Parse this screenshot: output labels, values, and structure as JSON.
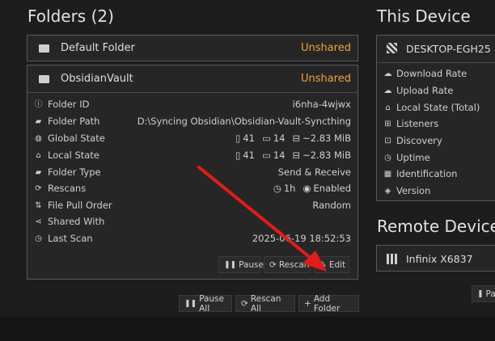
{
  "folders_section": {
    "title": "Folders (2)",
    "folders": [
      {
        "name": "Default Folder",
        "status": "Unshared"
      },
      {
        "name": "ObsidianVault",
        "status": "Unshared"
      }
    ],
    "details": {
      "folder_id": {
        "label": "Folder ID",
        "value": "i6nha-4wjwx"
      },
      "folder_path": {
        "label": "Folder Path",
        "value": "D:\\Syncing Obsidian\\Obsidian-Vault-Syncthing"
      },
      "global_state": {
        "label": "Global State",
        "files": "41",
        "dirs": "14",
        "size": "~2.83 MiB"
      },
      "local_state": {
        "label": "Local State",
        "files": "41",
        "dirs": "14",
        "size": "~2.83 MiB"
      },
      "folder_type": {
        "label": "Folder Type",
        "value": "Send & Receive"
      },
      "rescans": {
        "label": "Rescans",
        "interval": "1h",
        "watch": "Enabled"
      },
      "file_pull_order": {
        "label": "File Pull Order",
        "value": "Random"
      },
      "shared_with": {
        "label": "Shared With",
        "value": ""
      },
      "last_scan": {
        "label": "Last Scan",
        "value": "2025-06-19 18:52:53"
      }
    },
    "folder_buttons": {
      "pause": "Pause",
      "rescan": "Rescan",
      "edit": "Edit"
    },
    "footer_buttons": {
      "pause_all": "Pause All",
      "rescan_all": "Rescan All",
      "add_folder": "Add Folder"
    }
  },
  "this_device": {
    "title": "This Device",
    "name": "DESKTOP-EGH25",
    "rows": [
      "Download Rate",
      "Upload Rate",
      "Local State (Total)",
      "Listeners",
      "Discovery",
      "Uptime",
      "Identification",
      "Version"
    ]
  },
  "remote_devices": {
    "title": "Remote Devices",
    "device_name": "Infinix X6837",
    "partial_button": "Pa"
  },
  "colors": {
    "accent_orange": "#f0a33b",
    "arrow_red": "#e31b1b"
  }
}
